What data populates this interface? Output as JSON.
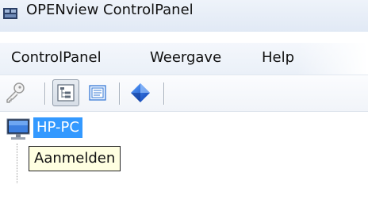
{
  "window": {
    "title": "OPENview ControlPanel"
  },
  "menubar": {
    "items": [
      {
        "label": "ControlPanel"
      },
      {
        "label": "Weergave"
      },
      {
        "label": "Help"
      }
    ]
  },
  "toolbar": {
    "buttons": [
      {
        "icon": "key-icon",
        "state": "disabled"
      },
      {
        "icon": "tree-view-icon",
        "state": "pressed"
      },
      {
        "icon": "detail-view-icon",
        "state": "normal"
      },
      {
        "icon": "openview-logo-icon",
        "state": "normal"
      }
    ]
  },
  "tree": {
    "nodes": [
      {
        "label": "HP-PC",
        "icon": "computer-icon",
        "selected": true
      }
    ]
  },
  "tooltip": {
    "text": "Aanmelden"
  },
  "colors": {
    "selection": "#3399ff",
    "tooltip_bg": "#ffffe1",
    "menubar_bg": "#eaf0f8"
  }
}
